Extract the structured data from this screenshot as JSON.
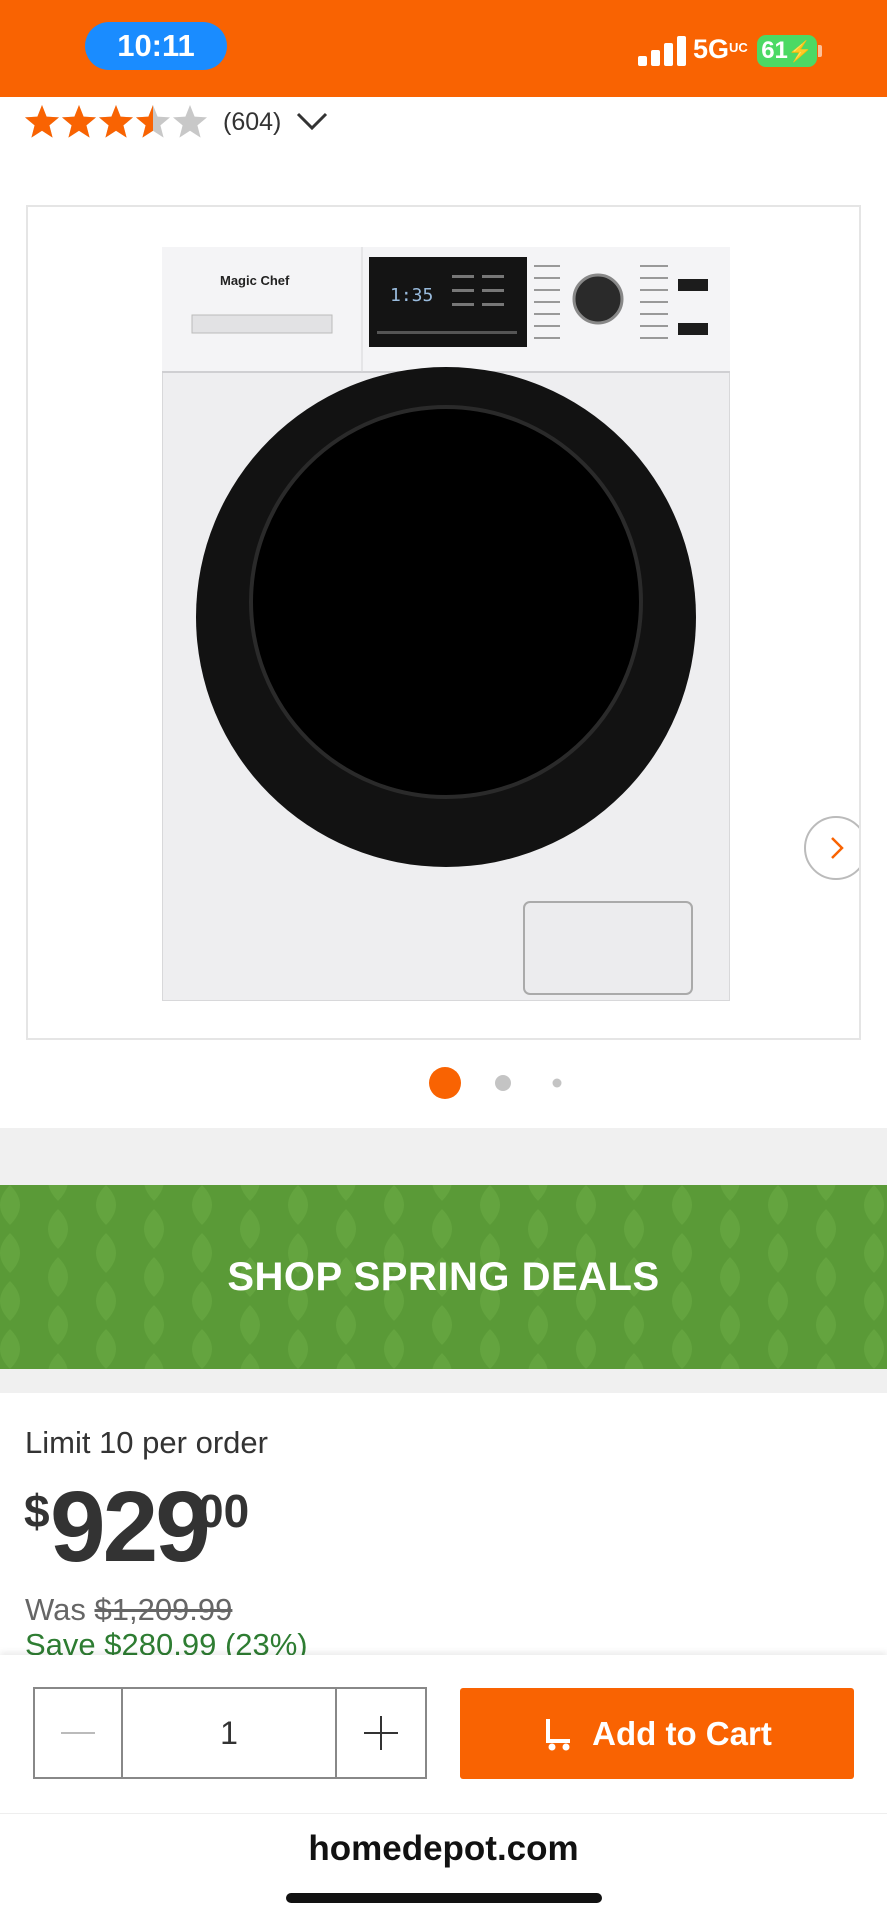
{
  "status_bar": {
    "time": "10:11",
    "network": "5G",
    "battery": "61",
    "accent_color": "#f96302"
  },
  "rating": {
    "stars": 3.5,
    "max_stars": 5,
    "review_count": "(604)",
    "star_color": "#f96302"
  },
  "gallery": {
    "image_count": 3,
    "active_index": 0,
    "product_brand": "Magic Chef",
    "display_readout": "1:35",
    "next_icon": "chevron-right-icon"
  },
  "promo": {
    "text": "SHOP SPRING DEALS",
    "color": "#5a9a37"
  },
  "pricing": {
    "limit": "Limit 10 per order",
    "currency": "$",
    "dollars": "929",
    "cents": "00",
    "was_label": "Was",
    "was_price": "$1,209.99",
    "save_text": "Save $280.99 (23%)"
  },
  "cart": {
    "quantity": "1",
    "add_label": "Add to Cart",
    "button_color": "#f96302"
  },
  "browser": {
    "url": "homedepot.com"
  }
}
